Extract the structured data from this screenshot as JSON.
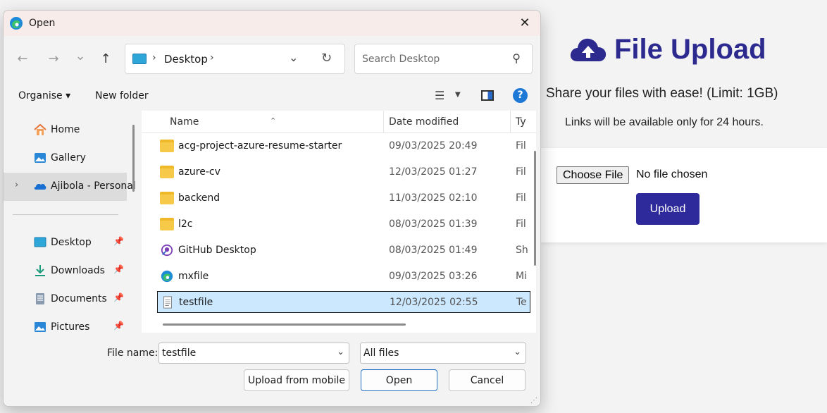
{
  "web": {
    "title": "File Upload",
    "subtitle": "Share your files with ease! (Limit: 1GB)",
    "note": "Links will be available only for 24 hours.",
    "choose_file_label": "Choose File",
    "no_file_text": "No file chosen",
    "upload_label": "Upload",
    "brand_color": "#2d2a8f"
  },
  "dialog": {
    "title": "Open",
    "close_glyph": "✕",
    "nav": {
      "back": "←",
      "forward": "→",
      "recent": "⌄",
      "up": "↑"
    },
    "address": {
      "sep": "›",
      "crumb": "Desktop",
      "dropdown": "⌄",
      "refresh": "↻"
    },
    "search": {
      "placeholder": "Search Desktop",
      "icon": "⚲"
    },
    "command_bar": {
      "organise": "Organise ▾",
      "new_folder": "New folder",
      "view_icon": "☰",
      "view_caret": "▼",
      "help": "?"
    },
    "sidebar": {
      "items": [
        {
          "label": "Home",
          "icon": "home-icon",
          "pinned": false
        },
        {
          "label": "Gallery",
          "icon": "gallery-icon",
          "pinned": false
        },
        {
          "label": "Ajibola - Personal",
          "icon": "onedrive-icon",
          "pinned": false,
          "selected": true
        },
        {
          "label": "Desktop",
          "icon": "desktop-icon",
          "pinned": true
        },
        {
          "label": "Downloads",
          "icon": "downloads-icon",
          "pinned": true
        },
        {
          "label": "Documents",
          "icon": "documents-icon",
          "pinned": true
        },
        {
          "label": "Pictures",
          "icon": "pictures-icon",
          "pinned": true
        }
      ],
      "pin_glyph": "📌",
      "expand_glyph": "›"
    },
    "columns": {
      "name": "Name",
      "date": "Date modified",
      "type": "Ty",
      "sort_glyph": "⌃"
    },
    "files": [
      {
        "name": "acg-project-azure-resume-starter",
        "date": "09/03/2025 20:49",
        "type": "Fil",
        "icon": "folder-icon"
      },
      {
        "name": "azure-cv",
        "date": "12/03/2025 01:27",
        "type": "Fil",
        "icon": "folder-icon"
      },
      {
        "name": "backend",
        "date": "11/03/2025 02:10",
        "type": "Fil",
        "icon": "folder-icon"
      },
      {
        "name": "l2c",
        "date": "08/03/2025 01:39",
        "type": "Fil",
        "icon": "folder-icon"
      },
      {
        "name": "GitHub Desktop",
        "date": "08/03/2025 01:49",
        "type": "Sh",
        "icon": "github-desktop-icon"
      },
      {
        "name": "mxfile",
        "date": "09/03/2025 03:26",
        "type": "Mi",
        "icon": "edge-icon"
      },
      {
        "name": "testfile",
        "date": "12/03/2025 02:55",
        "type": "Te",
        "icon": "text-file-icon",
        "selected": true
      }
    ],
    "footer": {
      "file_name_label": "File name:",
      "file_name_value": "testfile",
      "filter_value": "All files",
      "dropdown": "⌄",
      "upload_mobile": "Upload from mobile",
      "open": "Open",
      "cancel": "Cancel",
      "grip": "⋰"
    }
  }
}
